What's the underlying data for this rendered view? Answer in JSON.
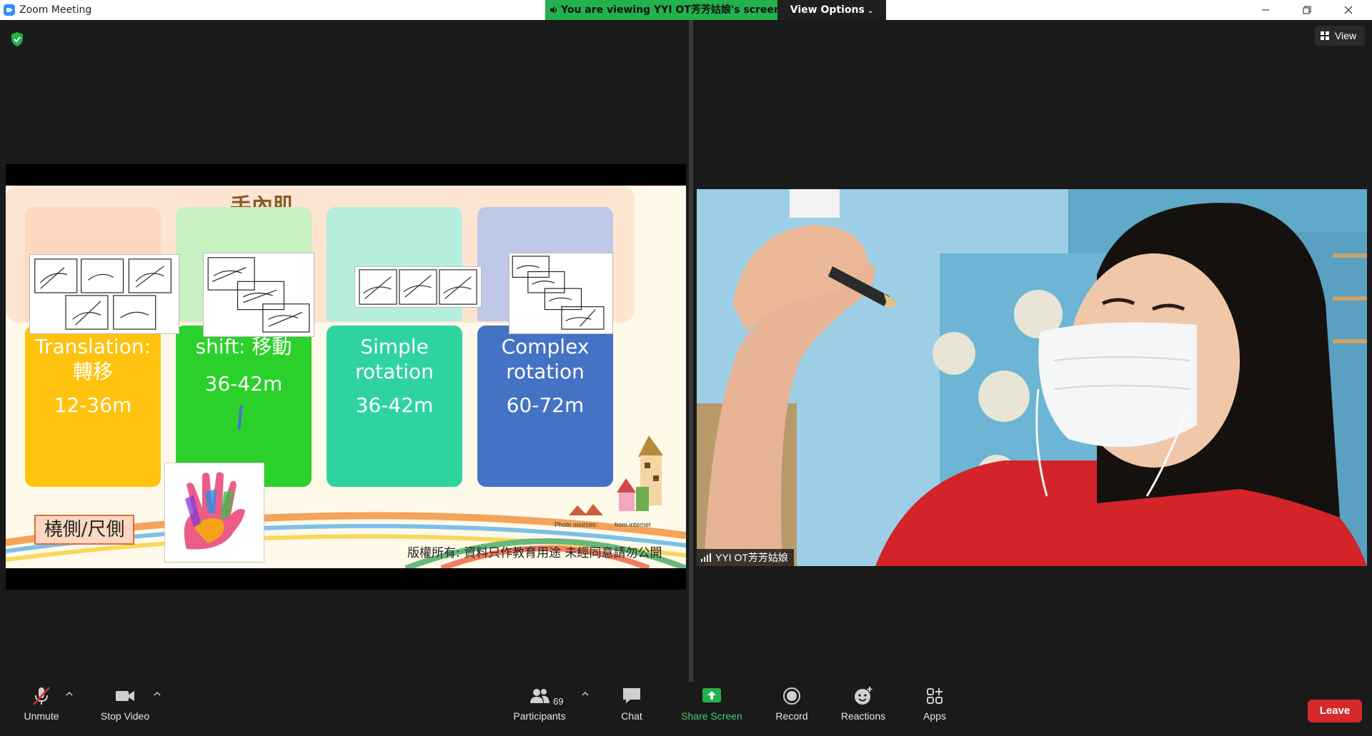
{
  "window": {
    "title": "Zoom Meeting",
    "viewing_banner": "You are viewing YYI OT芳芳姑娘's screen",
    "view_options_label": "View Options"
  },
  "stage": {
    "view_label": "View"
  },
  "slide": {
    "title": "手內肌",
    "cards": [
      {
        "line1": "Translation:",
        "line2": "轉移",
        "age": "12-36m",
        "color": "#ffc20e"
      },
      {
        "line1": "shift: 移動",
        "line2": "",
        "age": "36-42m",
        "color": "#2bd12b"
      },
      {
        "line1": "Simple",
        "line2": "rotation",
        "age": "36-42m",
        "color": "#2fd3a0"
      },
      {
        "line1": "Complex",
        "line2": "rotation",
        "age": "60-72m",
        "color": "#4472c4"
      }
    ],
    "side_label": "橈側/尺側",
    "copyright": "版權所有: 資料只作教育用途 未經同意請勿公開",
    "photo_sources_label": "Photo sources:",
    "photo_sources_value": "from internet"
  },
  "participant": {
    "name": "YYI OT芳芳姑娘"
  },
  "toolbar": {
    "unmute_label": "Unmute",
    "stop_video_label": "Stop Video",
    "participants_label": "Participants",
    "participants_count": "69",
    "chat_label": "Chat",
    "share_screen_label": "Share Screen",
    "record_label": "Record",
    "reactions_label": "Reactions",
    "apps_label": "Apps",
    "leave_label": "Leave"
  },
  "colors": {
    "banner_green": "#22b14c",
    "share_green": "#3fd36a",
    "leave_red": "#d62a2a",
    "zoom_blue": "#2d8cff"
  },
  "icons": [
    "zoom-logo-icon",
    "speaker-icon",
    "chevron-down-icon",
    "minimize-icon",
    "restore-icon",
    "close-icon",
    "shield-check-icon",
    "grid-view-icon",
    "signal-icon",
    "muted-mic-icon",
    "video-camera-icon",
    "participants-icon",
    "chat-bubble-icon",
    "share-screen-icon",
    "record-icon",
    "reactions-icon",
    "apps-icon"
  ]
}
